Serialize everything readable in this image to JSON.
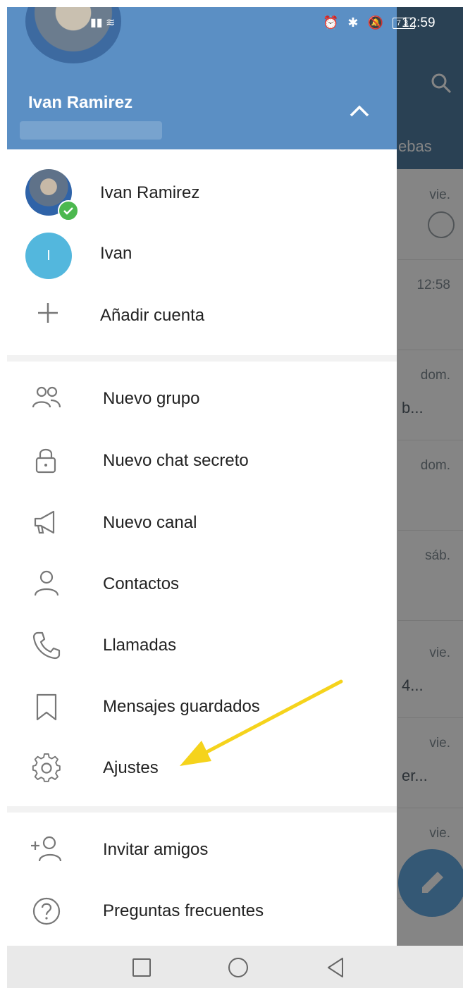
{
  "status_bar": {
    "time": "12:59",
    "battery": "73"
  },
  "background": {
    "tab_partial": "ebas",
    "rows": [
      {
        "time": "vie.",
        "snippet": ""
      },
      {
        "time": "12:58",
        "snippet": ""
      },
      {
        "time": "dom.",
        "snippet": "b..."
      },
      {
        "time": "dom.",
        "snippet": ""
      },
      {
        "time": "sáb.",
        "snippet": ""
      },
      {
        "time": "vie.",
        "snippet": "4..."
      },
      {
        "time": "vie.",
        "snippet": "er..."
      },
      {
        "time": "vie.",
        "snippet": ""
      }
    ]
  },
  "drawer": {
    "header": {
      "name": "Ivan Ramirez"
    },
    "accounts": [
      {
        "label": "Ivan Ramirez"
      },
      {
        "label": "Ivan",
        "initial": "I"
      },
      {
        "label": "Añadir cuenta"
      }
    ],
    "menu": [
      {
        "label": "Nuevo grupo",
        "icon": "group-icon"
      },
      {
        "label": "Nuevo chat secreto",
        "icon": "lock-icon"
      },
      {
        "label": "Nuevo canal",
        "icon": "megaphone-icon"
      },
      {
        "label": "Contactos",
        "icon": "person-icon"
      },
      {
        "label": "Llamadas",
        "icon": "phone-icon"
      },
      {
        "label": "Mensajes guardados",
        "icon": "bookmark-icon"
      },
      {
        "label": "Ajustes",
        "icon": "gear-icon"
      }
    ],
    "footer_menu": [
      {
        "label": "Invitar amigos",
        "icon": "add-person-icon"
      },
      {
        "label": "Preguntas frecuentes",
        "icon": "help-icon"
      }
    ]
  },
  "colors": {
    "header_blue": "#5b8fc4",
    "annotation_arrow": "#f5d31c"
  }
}
